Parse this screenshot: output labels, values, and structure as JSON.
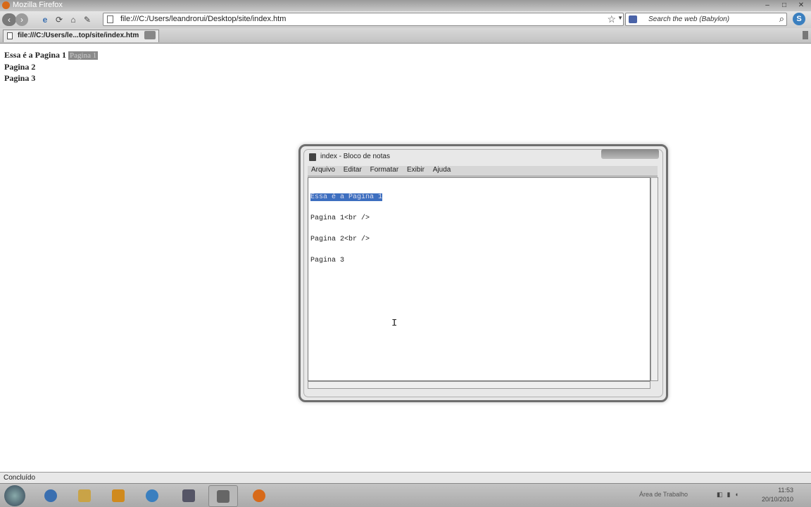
{
  "window": {
    "title": "Mozilla Firefox"
  },
  "navbar": {
    "back_label": "‹",
    "forward_label": "›",
    "url": "file:///C:/Users/leandrorui/Desktop/site/index.htm",
    "search_placeholder": "Search the web (Babylon)"
  },
  "tabbar": {
    "tab_label": "file:///C:/Users/le...top/site/index.htm"
  },
  "page": {
    "line1": "Essa é a Pagina 1",
    "line1_highlight": "Pagina 1",
    "line2": "Pagina 2",
    "line3": "Pagina 3"
  },
  "notepad": {
    "title": "index - Bloco de notas",
    "menu": [
      "Arquivo",
      "Editar",
      "Formatar",
      "Exibir",
      "Ajuda"
    ],
    "lines": [
      "Essa é a Pagina 1",
      "Pagina 1<br />",
      "Pagina 2<br />",
      "Pagina 3"
    ]
  },
  "statusbar": {
    "text": "Concluído"
  },
  "taskbar": {
    "tray_label": "Área de Trabalho",
    "time": "11:53",
    "date": "20/10/2010"
  },
  "icons": {
    "back": "back-arrow-icon",
    "forward": "forward-arrow-icon",
    "star": "bookmark-star-icon",
    "search": "magnifier-icon",
    "skype": "skype-icon",
    "cursor": "text-cursor-icon"
  },
  "colors": {
    "selection": "#3d6fc0",
    "chrome": "#cfcfcf"
  }
}
